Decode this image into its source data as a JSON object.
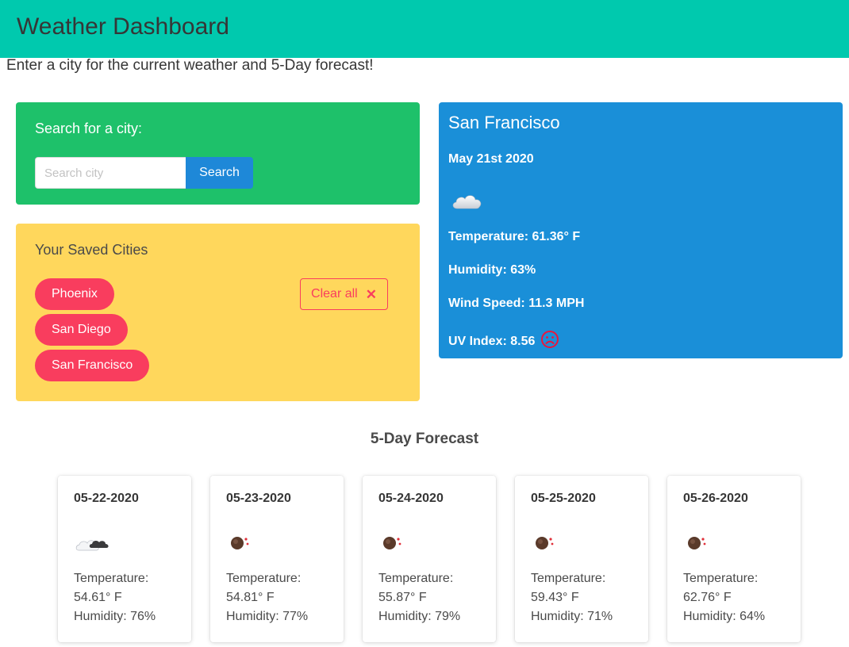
{
  "header": {
    "title": "Weather Dashboard",
    "subtitle": "Enter a city for the current weather and 5-Day forecast!"
  },
  "search": {
    "label": "Search for a city:",
    "placeholder": "Search city",
    "value": "",
    "button_label": "Search"
  },
  "saved": {
    "title": "Your Saved Cities",
    "cities": [
      "Phoenix",
      "San Diego",
      "San Francisco"
    ],
    "clear_label": "Clear all",
    "clear_icon": "close-icon"
  },
  "current": {
    "city": "San Francisco",
    "date": "May 21st 2020",
    "icon": "cloud-icon",
    "temperature": "Temperature: 61.36° F",
    "humidity": "Humidity: 63%",
    "wind": "Wind Speed: 11.3 MPH",
    "uv": "UV Index: 8.56",
    "uv_icon": "sad-face-icon"
  },
  "forecast": {
    "title": "5-Day Forecast",
    "temp_label": "Temperature:",
    "days": [
      {
        "date": "05-22-2020",
        "icon": "cloud-sun-icon",
        "temp": "54.61° F",
        "humidity": "Humidity: 76%"
      },
      {
        "date": "05-23-2020",
        "icon": "rain-drop-icon",
        "temp": "54.81° F",
        "humidity": "Humidity: 77%"
      },
      {
        "date": "05-24-2020",
        "icon": "rain-drop-icon",
        "temp": "55.87° F",
        "humidity": "Humidity: 79%"
      },
      {
        "date": "05-25-2020",
        "icon": "rain-drop-icon",
        "temp": "59.43° F",
        "humidity": "Humidity: 71%"
      },
      {
        "date": "05-26-2020",
        "icon": "rain-drop-icon",
        "temp": "62.76° F",
        "humidity": "Humidity: 64%"
      }
    ]
  },
  "colors": {
    "header_bg": "#00c9ae",
    "search_bg": "#1ec16a",
    "saved_bg": "#ffd75c",
    "current_bg": "#1a8fd8",
    "pill_bg": "#f93d5e",
    "button_bg": "#1e88d8"
  }
}
